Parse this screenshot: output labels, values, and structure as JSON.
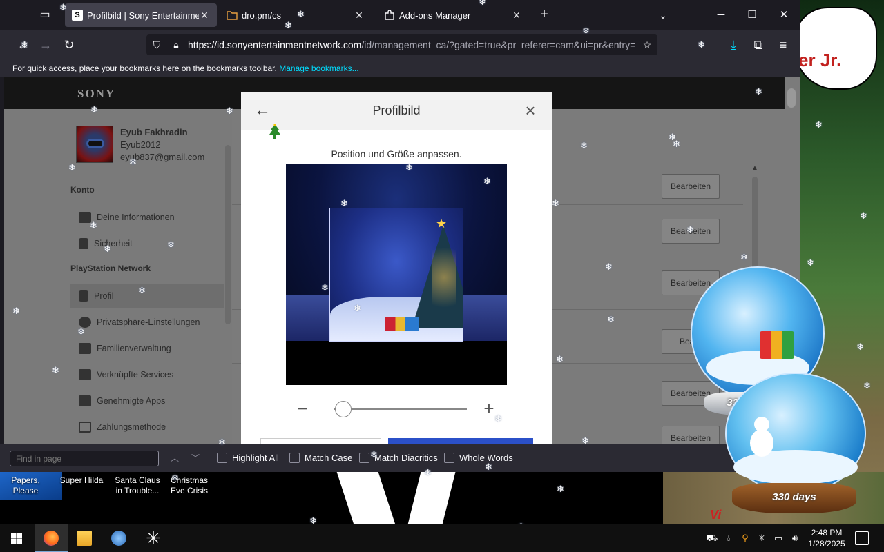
{
  "browser": {
    "tabs": [
      {
        "title": "Profilbild | Sony Entertainment Netwo",
        "favicon": "S",
        "active": true
      },
      {
        "title": "dro.pm/cs",
        "favicon": "folder-icon",
        "active": false
      },
      {
        "title": "Add-ons Manager",
        "favicon": "puzzle-icon",
        "active": false
      }
    ],
    "url_host": "https://id.sonyentertainmentnetwork.com",
    "url_path": "/id/management_ca/?gated=true&pr_referer=cam&ui=pr&entry=",
    "bookmarks_hint": "For quick access, place your bookmarks here on the bookmarks toolbar.",
    "bookmarks_link": "Manage bookmarks..."
  },
  "sony": {
    "logo": "SONY",
    "profile": {
      "name": "Eyub Fakhradin",
      "username": "Eyub2012",
      "email": "eyub837@gmail.com"
    },
    "sections": [
      {
        "heading": "Konto",
        "items": [
          "Deine Informationen",
          "Sicherheit"
        ]
      },
      {
        "heading": "PlayStation Network",
        "items": [
          "Profil",
          "Privatsphäre-Einstellungen",
          "Familienverwaltung",
          "Verknüpfte Services",
          "Genehmigte Apps",
          "Zahlungsmethode"
        ]
      }
    ],
    "active_item": "Profil",
    "edit_label": "Bearbeiten",
    "edit_label_partial": "Bearb"
  },
  "modal": {
    "title": "Profilbild",
    "hint": "Position und Größe anpassen.",
    "zoom_level": 0.07
  },
  "findbar": {
    "placeholder": "Find in page",
    "options": [
      "Highlight All",
      "Match Case",
      "Match Diacritics",
      "Whole Words"
    ]
  },
  "desktop": {
    "bubble_text": "er Jr.",
    "icons": [
      {
        "line1": "Papers,",
        "line2": "Please"
      },
      {
        "line1": "Super Hilda",
        "line2": ""
      },
      {
        "line1": "Santa Claus",
        "line2": "in Trouble..."
      },
      {
        "line1": "Christmas",
        "line2": "Eve Crisis"
      }
    ],
    "globe_label_1": "330 days",
    "globe_label_2": "330 days",
    "partial_text": "Vi"
  },
  "taskbar": {
    "time": "2:48 PM",
    "date": "1/28/2025"
  }
}
